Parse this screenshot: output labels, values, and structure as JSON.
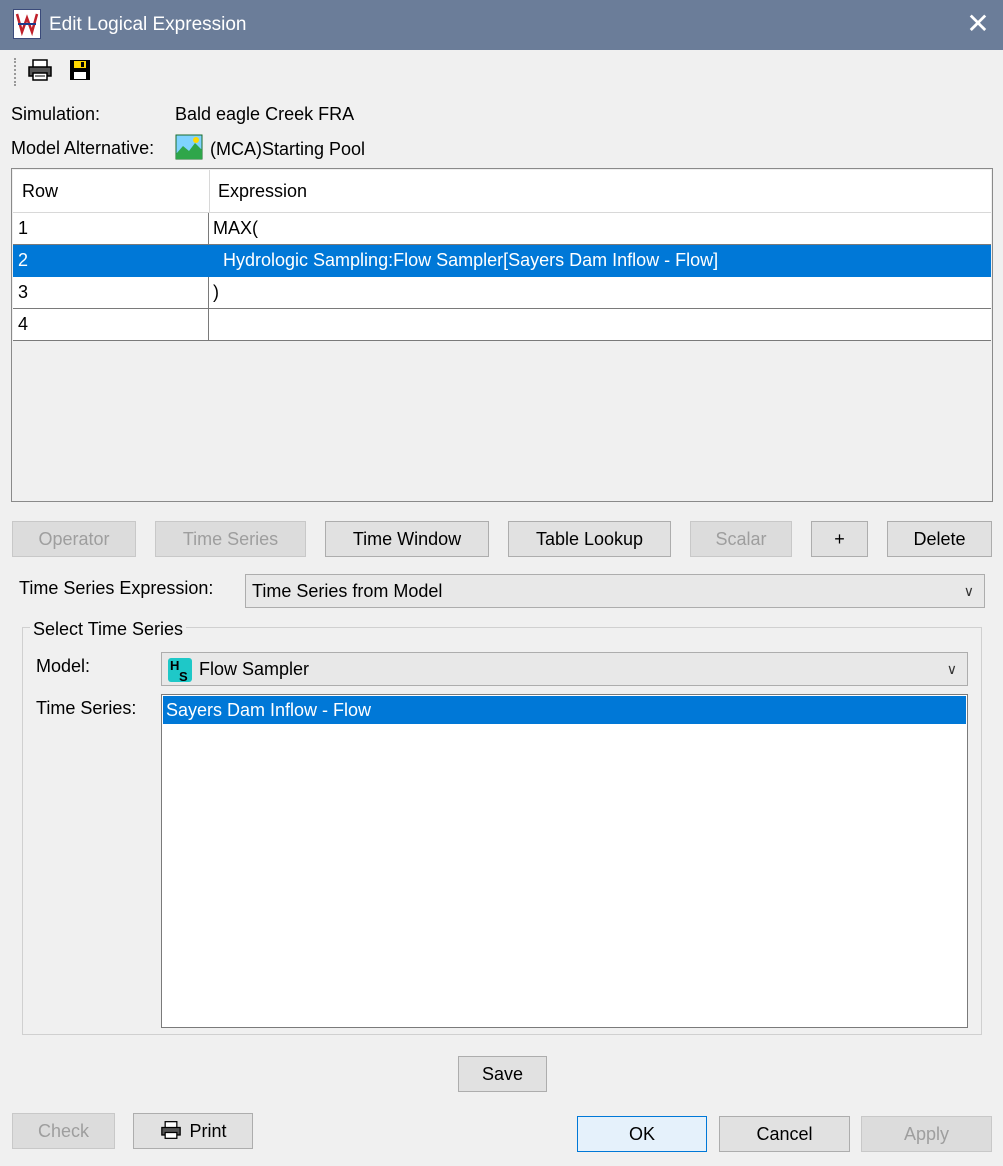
{
  "window": {
    "title": "Edit Logical Expression",
    "close_glyph": "✕"
  },
  "toolbar": {
    "print_icon": "printer-icon",
    "save_icon": "floppy-disk-icon"
  },
  "info": {
    "simulation_label": "Simulation:",
    "simulation_value": "Bald eagle Creek FRA",
    "model_alt_label": "Model Alternative:",
    "model_alt_value": "(MCA)Starting Pool"
  },
  "table": {
    "headers": [
      "Row",
      "Expression"
    ],
    "rows": [
      {
        "row": "1",
        "expression": "MAX("
      },
      {
        "row": "2",
        "expression": "  Hydrologic Sampling:Flow Sampler[Sayers Dam Inflow - Flow]"
      },
      {
        "row": "3",
        "expression": ")"
      },
      {
        "row": "4",
        "expression": ""
      }
    ],
    "selected_row": 2
  },
  "buttons": {
    "operator": "Operator",
    "time_series": "Time Series",
    "time_window": "Time Window",
    "table_lookup": "Table Lookup",
    "scalar": "Scalar",
    "plus": "+",
    "delete": "Delete",
    "save": "Save",
    "check": "Check",
    "print": "Print",
    "ok": "OK",
    "cancel": "Cancel",
    "apply": "Apply"
  },
  "ts_expression": {
    "label": "Time Series Expression:",
    "value": "Time Series from Model"
  },
  "select_ts": {
    "group_title": "Select Time Series",
    "model_label": "Model:",
    "model_value": "Flow Sampler",
    "ts_label": "Time Series:",
    "items": [
      "Sayers Dam Inflow - Flow"
    ],
    "selected_index": 0
  },
  "colors": {
    "titlebar": "#6b7d99",
    "selection": "#0078d7"
  }
}
